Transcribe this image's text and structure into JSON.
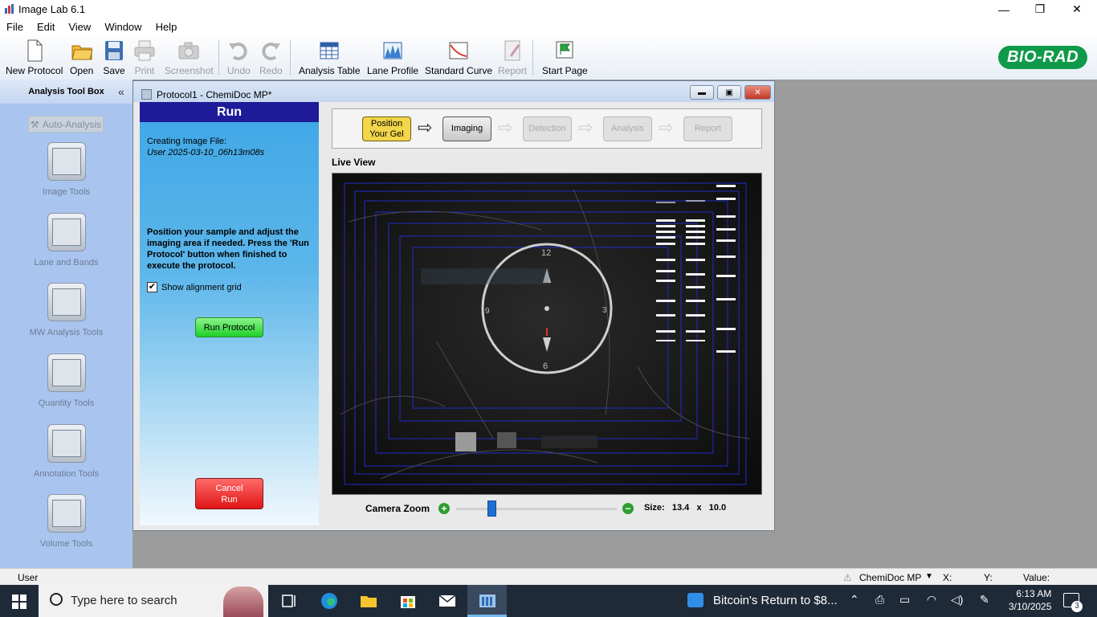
{
  "window": {
    "title": "Image Lab 6.1",
    "controls": [
      "minimize-icon",
      "restore-icon",
      "close-icon"
    ]
  },
  "menu": [
    "File",
    "Edit",
    "View",
    "Window",
    "Help"
  ],
  "toolbar": {
    "items": [
      {
        "label": "New Protocol",
        "icon": "new-document-icon",
        "enabled": true
      },
      {
        "label": "Open",
        "icon": "folder-open-icon",
        "enabled": true
      },
      {
        "label": "Save",
        "icon": "floppy-icon",
        "enabled": true
      },
      {
        "label": "Print",
        "icon": "printer-icon",
        "enabled": false
      },
      {
        "label": "Screenshot",
        "icon": "camera-icon",
        "enabled": false
      },
      {
        "label": "Undo",
        "icon": "undo-icon",
        "enabled": false
      },
      {
        "label": "Redo",
        "icon": "redo-icon",
        "enabled": false
      },
      {
        "label": "Analysis Table",
        "icon": "table-icon",
        "enabled": true
      },
      {
        "label": "Lane Profile",
        "icon": "profile-chart-icon",
        "enabled": true
      },
      {
        "label": "Standard Curve",
        "icon": "curve-chart-icon",
        "enabled": true
      },
      {
        "label": "Report",
        "icon": "report-icon",
        "enabled": false
      },
      {
        "label": "Start Page",
        "icon": "flag-icon",
        "enabled": true
      }
    ],
    "brand": "BIO-RAD",
    "brand_color": "#0f9a4a"
  },
  "sidebar": {
    "title": "Analysis Tool Box",
    "collapse": "«",
    "auto_button": "Auto-Analysis",
    "tools": [
      "Image Tools",
      "Lane and Bands",
      "MW Analysis Tools",
      "Quantity Tools",
      "Annotation Tools",
      "Volume Tools"
    ]
  },
  "dialog": {
    "title": "Protocol1 - ChemiDoc MP*",
    "panel": {
      "header": "Run",
      "creating_label": "Creating Image File:",
      "file_name": "User 2025-03-10_06h13m08s",
      "instructions": "Position your sample and adjust the imaging area if needed. Press the 'Run Protocol' button when finished to execute the protocol.",
      "grid_checkbox_label": "Show alignment grid",
      "grid_checked": true,
      "run_button": "Run Protocol",
      "cancel_line1": "Cancel",
      "cancel_line2": "Run"
    },
    "steps": [
      {
        "line1": "Position",
        "line2": "Your Gel",
        "state": "current"
      },
      {
        "line1": "Imaging",
        "line2": "",
        "state": "active"
      },
      {
        "line1": "Detection",
        "line2": "",
        "state": "disabled"
      },
      {
        "line1": "Analysis",
        "line2": "",
        "state": "disabled"
      },
      {
        "line1": "Report",
        "line2": "",
        "state": "disabled"
      }
    ],
    "live_view_label": "Live View",
    "target_numbers": {
      "top": "12",
      "bottom": "6",
      "left": "9",
      "right": "3"
    },
    "zoom": {
      "label": "Camera Zoom",
      "size_label": "Size:",
      "width": "13.4",
      "x": "x",
      "height": "10.0",
      "level_fraction": 0.22
    }
  },
  "status_bar": {
    "user": "User",
    "instrument": "ChemiDoc MP",
    "x_label": "X:",
    "y_label": "Y:",
    "value_label": "Value:"
  },
  "taskbar": {
    "search_placeholder": "Type here to search",
    "news": "Bitcoin's Return to $8...",
    "time": "6:13 AM",
    "date": "3/10/2025",
    "notifications": "3"
  }
}
